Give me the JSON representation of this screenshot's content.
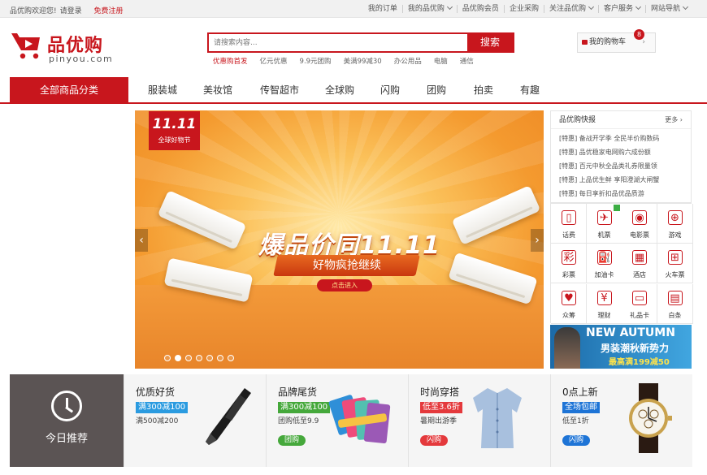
{
  "topbar": {
    "welcome": "品优购欢迎您!",
    "login": "请登录",
    "register": "免费注册",
    "links": [
      "我的订单",
      "我的品优购",
      "品优购会员",
      "企业采购",
      "关注品优购",
      "客户服务",
      "网站导航"
    ],
    "dropdown_links": [
      false,
      true,
      false,
      false,
      true,
      true,
      true
    ]
  },
  "header": {
    "logo_text": "品优购",
    "logo_domain": "pinyou.com",
    "search_placeholder": "请搜索内容...",
    "search_button": "搜索",
    "hotwords": [
      "优惠购首发",
      "亿元优惠",
      "9.9元团购",
      "美满99减30",
      "办公用品",
      "电脑",
      "通信"
    ],
    "cart_label": "我的购物车",
    "cart_count": "8",
    "cart_arrow": "›"
  },
  "nav": {
    "all_categories": "全部商品分类",
    "items": [
      "服装城",
      "美妆馆",
      "传智超市",
      "全球购",
      "闪购",
      "团购",
      "拍卖",
      "有趣"
    ]
  },
  "banner": {
    "badge_number": "11.11",
    "badge_text": "全球好物节",
    "title": "爆品价同11.11",
    "subtitle": "好物疯抢继续",
    "button": "点击进入",
    "prev": "‹",
    "next": "›",
    "slide_count": 7,
    "active_slide": 2
  },
  "news": {
    "title": "品优购快报",
    "more": "更多 ›",
    "items": [
      "[特惠] 备战开学季 全民半价购数码",
      "[特惠] 品优稳家电网购六成份额",
      "[特惠] 百元中秋全品类礼券限量领",
      "[特惠] 上品优生鲜 享阳澄湖大闸蟹",
      "[特惠] 每日享折扣品优品质游"
    ]
  },
  "services": [
    {
      "label": "话费",
      "icon": "phone-icon",
      "glyph": "▯"
    },
    {
      "label": "机票",
      "icon": "plane-icon",
      "glyph": "✈",
      "hot": true
    },
    {
      "label": "电影票",
      "icon": "film-reel-icon",
      "glyph": "◉"
    },
    {
      "label": "游戏",
      "icon": "gamepad-icon",
      "glyph": "⊕"
    },
    {
      "label": "彩票",
      "icon": "lottery-icon",
      "glyph": "彩"
    },
    {
      "label": "加油卡",
      "icon": "fuel-pump-icon",
      "glyph": "⛽"
    },
    {
      "label": "酒店",
      "icon": "hotel-icon",
      "glyph": "▦"
    },
    {
      "label": "火车票",
      "icon": "train-icon",
      "glyph": "⊞"
    },
    {
      "label": "众筹",
      "icon": "crowdfunding-icon",
      "glyph": "♥"
    },
    {
      "label": "理财",
      "icon": "finance-icon",
      "glyph": "¥"
    },
    {
      "label": "礼品卡",
      "icon": "gift-card-icon",
      "glyph": "▭"
    },
    {
      "label": "白条",
      "icon": "credit-note-icon",
      "glyph": "▤"
    }
  ],
  "ad": {
    "line1": "NEW AUTUMN",
    "line2": "男装潮秋新势力",
    "line3": "最高满199减50"
  },
  "today": {
    "label": "今日推荐"
  },
  "cards": [
    {
      "title": "优质好货",
      "tag": "满300减100",
      "desc": "满500减200",
      "button": "",
      "tag_color": "#2b9be0",
      "btn_color": "#2b9be0",
      "product": "vacuum-cleaner-image"
    },
    {
      "title": "品牌尾货",
      "tag": "满300减100",
      "desc": "团购低至9.9",
      "button": "团购",
      "tag_color": "#45a83b",
      "btn_color": "#45a83b",
      "product": "towels-image"
    },
    {
      "title": "时尚穿搭",
      "tag": "低至3.6折",
      "desc": "暑期出游季",
      "button": "闪购",
      "tag_color": "#e4393c",
      "btn_color": "#e4393c",
      "product": "shirt-image"
    },
    {
      "title": "0点上新",
      "tag": "全场包邮",
      "desc": "低至1折",
      "button": "闪购",
      "tag_color": "#1e74d6",
      "btn_color": "#1e74d6",
      "product": "watch-image"
    }
  ],
  "colors": {
    "brand": "#c8161d"
  }
}
